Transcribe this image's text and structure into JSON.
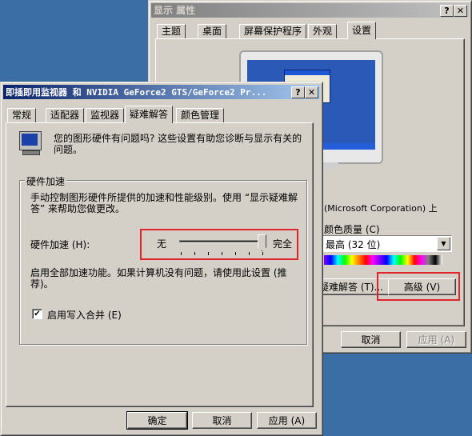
{
  "display_props": {
    "title": "显示 属性",
    "help_btn": "?",
    "close_btn": "✕",
    "tabs": [
      "主题",
      "桌面",
      "屏幕保护程序",
      "外观",
      "设置"
    ],
    "adapter_text": "(Microsoft Corporation) 上",
    "color_quality_label": "颜色质量 (C)",
    "color_value": "最高 (32 位)",
    "troubleshoot_btn": "疑难解答 (T)...",
    "advanced_btn": "高级 (V)",
    "cancel_btn": "取消",
    "apply_btn": "应用 (A)"
  },
  "adv": {
    "title": "即插即用监视器 和 NVIDIA GeForce2 GTS/GeForce2 Pr...",
    "help_btn": "?",
    "close_btn": "✕",
    "tabs": [
      "常规",
      "适配器",
      "监视器",
      "疑难解答",
      "颜色管理"
    ],
    "info_text_1": "您的图形硬件有问题吗? 这些设置有助您诊断与显示有关的",
    "info_text_2": "问题。",
    "group_label": "硬件加速",
    "group_desc_1": "手动控制图形硬件所提供的加速和性能级别。使用 “显示疑难解",
    "group_desc_2": "答” 来帮助您做更改。",
    "accel_label": "硬件加速 (H):",
    "slider_min": "无",
    "slider_max": "完全",
    "slider_level": 1.0,
    "status_1": "启用全部加速功能。如果计算机没有问题，请使用此设置 (推",
    "status_2": "荐)。",
    "write_combine_label": "启用写入合并 (E)",
    "write_combine_checked": "✔",
    "ok_btn": "确定",
    "cancel_btn": "取消",
    "apply_btn": "应用 (A)"
  },
  "colors": {
    "highlight": "#e0242b",
    "desktop": "#3a6ea5",
    "titlebar_active": "#0a246a"
  }
}
